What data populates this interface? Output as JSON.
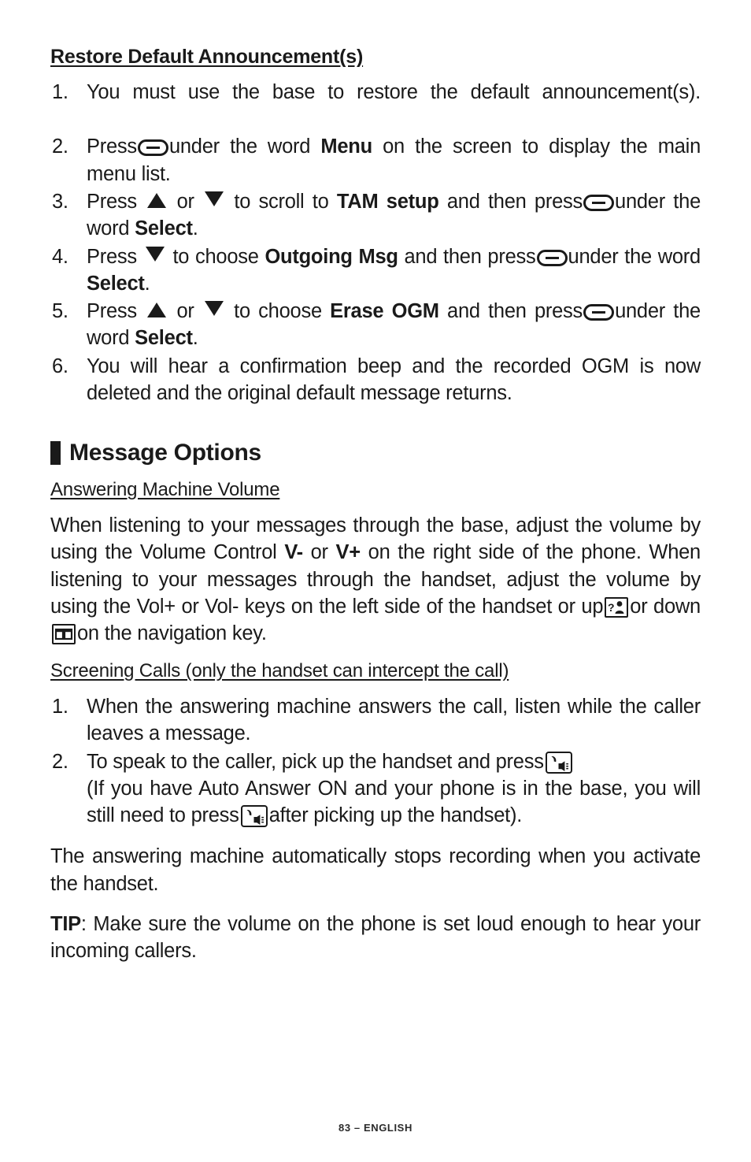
{
  "page": {
    "footer": "83 – ENGLISH"
  },
  "section_restore": {
    "heading": "Restore Default Announcement(s)",
    "steps": [
      {
        "num": "1.",
        "parts": [
          {
            "type": "text",
            "value": "You must use the base to restore the default announcement(s)."
          }
        ]
      },
      {
        "num": "2.",
        "parts": [
          {
            "type": "text",
            "value": "Press"
          },
          {
            "type": "icon",
            "value": "softkey-icon"
          },
          {
            "type": "text",
            "value": "under the word "
          },
          {
            "type": "bold",
            "value": "Menu"
          },
          {
            "type": "text",
            "value": " on the screen to display the main menu list."
          }
        ]
      },
      {
        "num": "3.",
        "parts": [
          {
            "type": "text",
            "value": "Press "
          },
          {
            "type": "icon",
            "value": "triangle-up-icon"
          },
          {
            "type": "text",
            "value": " or "
          },
          {
            "type": "icon",
            "value": "triangle-down-icon"
          },
          {
            "type": "text",
            "value": " to scroll to "
          },
          {
            "type": "bold",
            "value": "TAM setup"
          },
          {
            "type": "text",
            "value": " and then press"
          },
          {
            "type": "icon",
            "value": "softkey-icon"
          },
          {
            "type": "text",
            "value": "under the word "
          },
          {
            "type": "bold",
            "value": "Select"
          },
          {
            "type": "text",
            "value": "."
          }
        ]
      },
      {
        "num": "4.",
        "parts": [
          {
            "type": "text",
            "value": "Press "
          },
          {
            "type": "icon",
            "value": "triangle-down-icon"
          },
          {
            "type": "text",
            "value": " to choose "
          },
          {
            "type": "bold",
            "value": "Outgoing Msg"
          },
          {
            "type": "text",
            "value": " and then press"
          },
          {
            "type": "icon",
            "value": "softkey-icon"
          },
          {
            "type": "text",
            "value": "under the word "
          },
          {
            "type": "bold",
            "value": "Select"
          },
          {
            "type": "text",
            "value": "."
          }
        ]
      },
      {
        "num": "5.",
        "parts": [
          {
            "type": "text",
            "value": "Press "
          },
          {
            "type": "icon",
            "value": "triangle-up-icon"
          },
          {
            "type": "text",
            "value": " or "
          },
          {
            "type": "icon",
            "value": "triangle-down-icon"
          },
          {
            "type": "text",
            "value": " to choose "
          },
          {
            "type": "bold",
            "value": "Erase OGM"
          },
          {
            "type": "text",
            "value": " and then press"
          },
          {
            "type": "icon",
            "value": "softkey-icon"
          },
          {
            "type": "text",
            "value": "under the word "
          },
          {
            "type": "bold",
            "value": "Select"
          },
          {
            "type": "text",
            "value": "."
          }
        ]
      },
      {
        "num": "6.",
        "parts": [
          {
            "type": "text",
            "value": "You will hear a confirmation beep and the recorded OGM is now deleted and the original default message returns."
          }
        ]
      }
    ],
    "step_1_text": "You must use the base to restore the default announcement(s).",
    "step_2_text_a": "Press",
    "step_2_text_b": "under the word ",
    "step_2_bold": "Menu",
    "step_2_text_c": " on the screen to display the main menu list.",
    "step_3_text_a": "Press ",
    "step_3_text_b": " or ",
    "step_3_text_c": " to scroll to ",
    "step_3_bold_a": "TAM setup",
    "step_3_text_d": " and then press",
    "step_3_text_e": "under the word ",
    "step_3_bold_b": "Select",
    "step_3_text_f": ".",
    "step_4_text_a": "Press ",
    "step_4_text_b": " to choose ",
    "step_4_bold_a": "Outgoing Msg",
    "step_4_text_c": " and then press",
    "step_4_text_d": "under the word ",
    "step_4_bold_b": "Select",
    "step_4_text_e": ".",
    "step_5_text_a": "Press ",
    "step_5_text_b": " or ",
    "step_5_text_c": " to choose ",
    "step_5_bold_a": "Erase OGM",
    "step_5_text_d": " and then press",
    "step_5_text_e": "under the word ",
    "step_5_bold_b": "Select",
    "step_5_text_f": ".",
    "step_6_text": "You will hear a confirmation beep and the recorded OGM is now deleted and the original default message returns.",
    "numbers": [
      "1.",
      "2.",
      "3.",
      "4.",
      "5.",
      "6."
    ]
  },
  "section_message_options": {
    "heading": "Message Options",
    "volume": {
      "heading": "Answering Machine Volume",
      "text_a": "When listening to your messages through the base, adjust the volume by using the Volume Control ",
      "bold_a": "V-",
      "text_b": " or ",
      "bold_b": "V+",
      "text_c": " on the right side of the phone.  When listening to your messages through the handset, adjust the volume by using the Vol+ or Vol- keys on the left side of the handset or up",
      "text_d": "or down",
      "text_e": "on the navigation key."
    },
    "screening": {
      "heading": "Screening Calls (only the handset can intercept the call)",
      "numbers": [
        "1.",
        "2."
      ],
      "step_1_text": "When the answering machine answers the call, listen while the caller leaves a message.",
      "step_2_text_a": "To speak to the caller, pick up the handset and press",
      "step_2_text_b": "(If you have Auto Answer ON and your phone is in the base, you will still need to press",
      "step_2_text_c": "after picking up the handset)."
    },
    "note_text": "The answering machine automatically stops recording when you activate the handset.",
    "tip_label": "TIP",
    "tip_text": ": Make sure the volume on the phone is set loud enough to hear your incoming callers."
  },
  "icons": {
    "softkey": "softkey-icon",
    "triangle_up": "triangle-up-icon",
    "triangle_down": "triangle-down-icon",
    "nav_up_callerid": "caller-id-key-icon",
    "nav_down_phonebook": "phonebook-key-icon",
    "talk_speaker": "talk-speakerphone-key-icon"
  }
}
